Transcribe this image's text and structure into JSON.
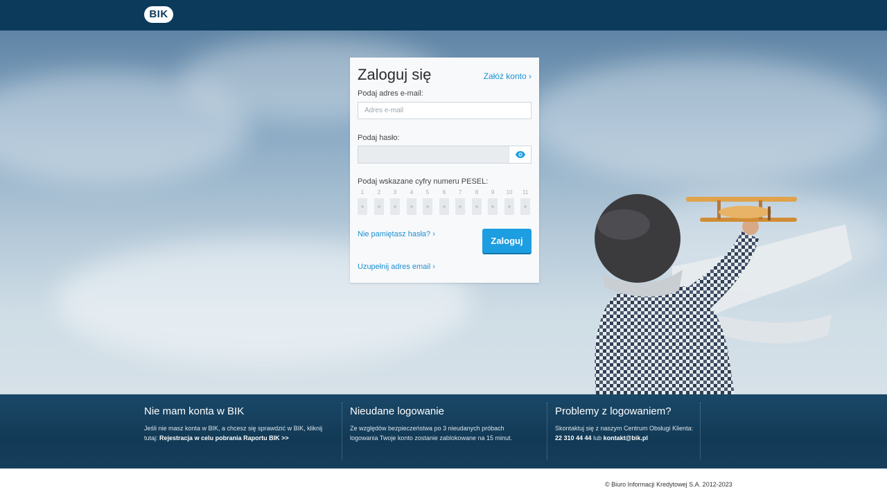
{
  "header": {
    "logo_text": "BIK"
  },
  "login": {
    "title": "Zaloguj się",
    "register_link": "Załóż konto ›",
    "email_label": "Podaj adres e-mail:",
    "email_placeholder": "Adres e-mail",
    "email_value": "",
    "password_label": "Podaj hasło:",
    "password_value": "",
    "show_password_icon": "eye-icon",
    "pesel_label": "Podaj wskazane cyfry numeru PESEL:",
    "pesel_digits": [
      "1",
      "2",
      "3",
      "4",
      "5",
      "6",
      "7",
      "8",
      "9",
      "10",
      "11"
    ],
    "forgot_link": "Nie pamiętasz hasła? ›",
    "login_button": "Zaloguj",
    "complete_email_link": "Uzupełnij adres email ›"
  },
  "info": {
    "col1": {
      "title": "Nie mam konta w BIK",
      "text": "Jeśli nie masz konta w BIK, a chcesz się sprawdzić w BIK, kliknij tutaj:",
      "link": "Rejestracja w celu pobrania Raportu BIK >>"
    },
    "col2": {
      "title": "Nieudane logowanie",
      "text": "Ze względów bezpieczeństwa po 3 nieudanych próbach logowania Twoje konto zostanie zablokowane na 15 minut."
    },
    "col3": {
      "title": "Problemy z logowaniem?",
      "text": "Skontaktuj się z naszym Centrum Obsługi Klienta:",
      "phone": "22 310 44 44",
      "or": "lub",
      "email": "kontakt@bik.pl"
    }
  },
  "footer": {
    "copyright": "© Biuro Informacji Kredytowej S.A. 2012-2023"
  },
  "colors": {
    "header_bg": "#0b3a5a",
    "accent": "#1d9ee0",
    "link": "#1e8fd0",
    "infobar_bg": "#123a56"
  }
}
